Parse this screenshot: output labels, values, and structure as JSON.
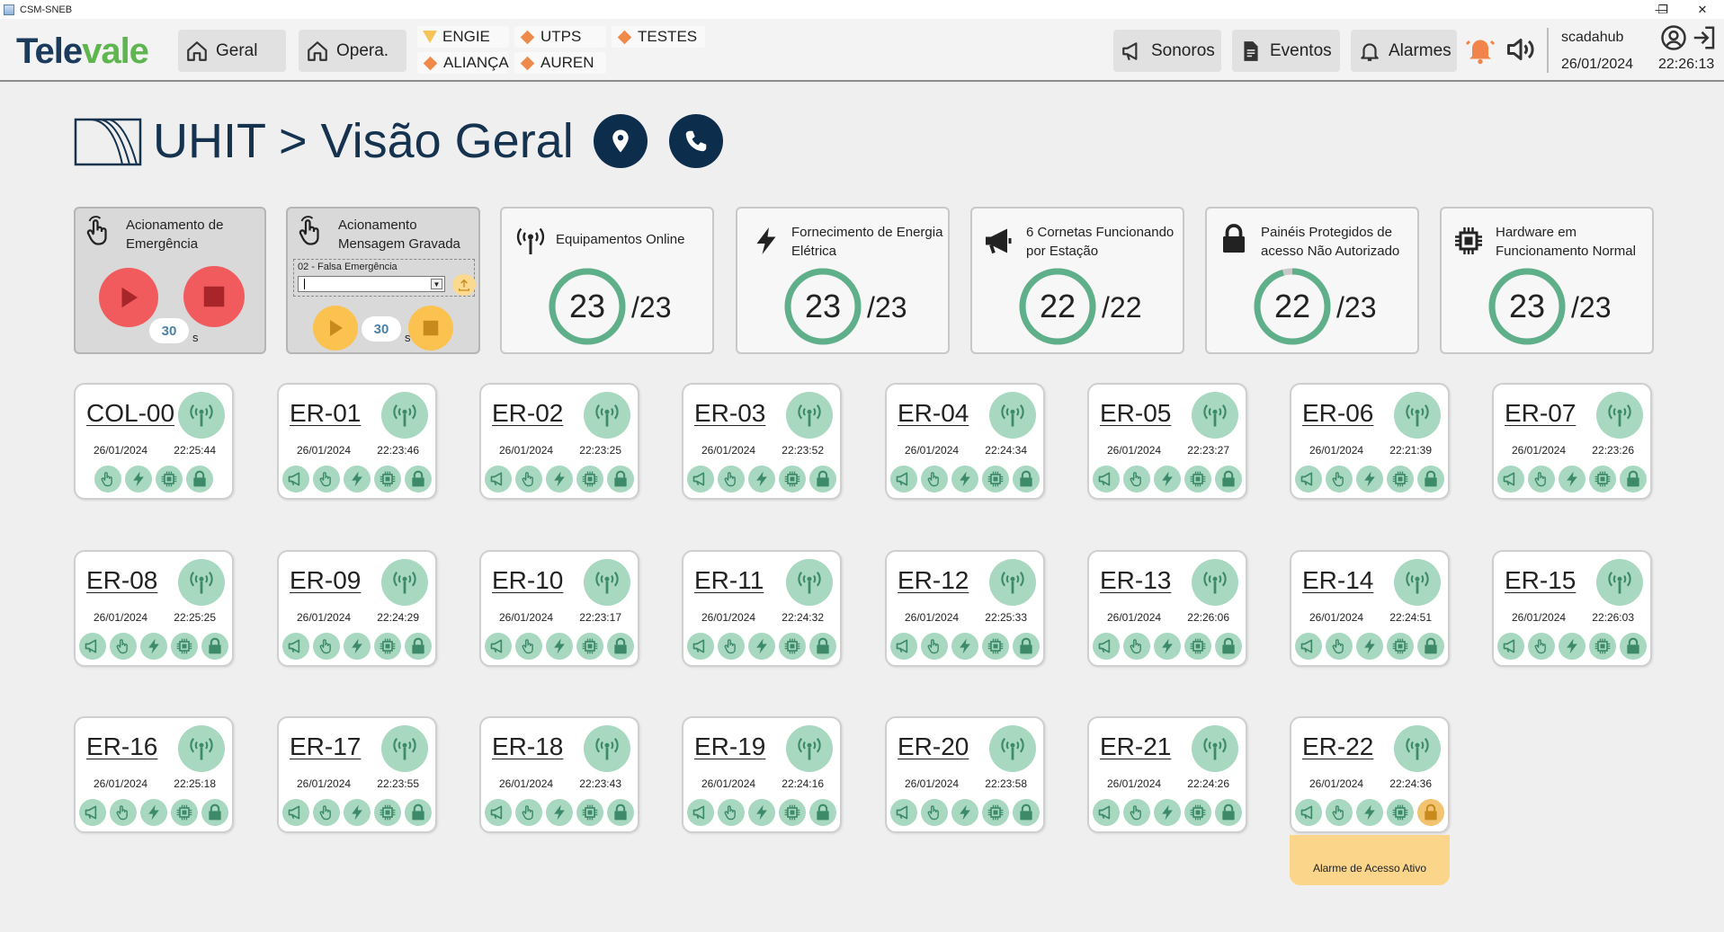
{
  "window": {
    "title": "CSM-SNEB",
    "controls": [
      "—",
      "❐",
      "✕"
    ]
  },
  "brand": {
    "logo_part1": "Tele",
    "logo_part2": "vale"
  },
  "nav": {
    "geral": "Geral",
    "opera": "Opera."
  },
  "companies": [
    "ENGIE",
    "UTPS",
    "TESTES",
    "ALIANÇA",
    "AUREN"
  ],
  "toolbar": {
    "sonoros": "Sonoros",
    "eventos": "Eventos",
    "alarmes": "Alarmes"
  },
  "user": {
    "name": "scadahub",
    "date": "26/01/2024",
    "time": "22:26:13"
  },
  "page": {
    "title": "UHIT > Visão Geral"
  },
  "actions": {
    "emergency": {
      "label": "Acionamento de Emergência",
      "seconds": "30",
      "unit": "s"
    },
    "recorded": {
      "label": "Acionamento Mensagem Gravada",
      "message_label": "02 - Falsa Emergência",
      "message_value": "",
      "seconds": "30",
      "unit": "s"
    }
  },
  "summary": [
    {
      "label": "Equipamentos Online",
      "value": 23,
      "total": "/23",
      "icon": "antenna-icon"
    },
    {
      "label": "Fornecimento de Energia Elétrica",
      "value": 23,
      "total": "/23",
      "icon": "lightning-icon"
    },
    {
      "label": "6 Cornetas Funcionando por Estação",
      "value": 22,
      "total": "/22",
      "icon": "megaphone-icon"
    },
    {
      "label": "Painéis Protegidos de acesso Não Autorizado",
      "value": 22,
      "total": "/23",
      "icon": "lock-icon"
    },
    {
      "label": "Hardware em Funcionamento Normal",
      "value": 23,
      "total": "/23",
      "icon": "chip-icon"
    }
  ],
  "stations": [
    {
      "name": "COL-00",
      "date": "26/01/2024",
      "time": "22:25:44",
      "horn": false,
      "alarm": false
    },
    {
      "name": "ER-01",
      "date": "26/01/2024",
      "time": "22:23:46",
      "horn": true,
      "alarm": false
    },
    {
      "name": "ER-02",
      "date": "26/01/2024",
      "time": "22:23:25",
      "horn": true,
      "alarm": false
    },
    {
      "name": "ER-03",
      "date": "26/01/2024",
      "time": "22:23:52",
      "horn": true,
      "alarm": false
    },
    {
      "name": "ER-04",
      "date": "26/01/2024",
      "time": "22:24:34",
      "horn": true,
      "alarm": false
    },
    {
      "name": "ER-05",
      "date": "26/01/2024",
      "time": "22:23:27",
      "horn": true,
      "alarm": false
    },
    {
      "name": "ER-06",
      "date": "26/01/2024",
      "time": "22:21:39",
      "horn": true,
      "alarm": false
    },
    {
      "name": "ER-07",
      "date": "26/01/2024",
      "time": "22:23:26",
      "horn": true,
      "alarm": false
    },
    {
      "name": "ER-08",
      "date": "26/01/2024",
      "time": "22:25:25",
      "horn": true,
      "alarm": false
    },
    {
      "name": "ER-09",
      "date": "26/01/2024",
      "time": "22:24:29",
      "horn": true,
      "alarm": false
    },
    {
      "name": "ER-10",
      "date": "26/01/2024",
      "time": "22:23:17",
      "horn": true,
      "alarm": false
    },
    {
      "name": "ER-11",
      "date": "26/01/2024",
      "time": "22:24:32",
      "horn": true,
      "alarm": false
    },
    {
      "name": "ER-12",
      "date": "26/01/2024",
      "time": "22:25:33",
      "horn": true,
      "alarm": false
    },
    {
      "name": "ER-13",
      "date": "26/01/2024",
      "time": "22:26:06",
      "horn": true,
      "alarm": false
    },
    {
      "name": "ER-14",
      "date": "26/01/2024",
      "time": "22:24:51",
      "horn": true,
      "alarm": false
    },
    {
      "name": "ER-15",
      "date": "26/01/2024",
      "time": "22:26:03",
      "horn": true,
      "alarm": false
    },
    {
      "name": "ER-16",
      "date": "26/01/2024",
      "time": "22:25:18",
      "horn": true,
      "alarm": false
    },
    {
      "name": "ER-17",
      "date": "26/01/2024",
      "time": "22:23:55",
      "horn": true,
      "alarm": false
    },
    {
      "name": "ER-18",
      "date": "26/01/2024",
      "time": "22:23:43",
      "horn": true,
      "alarm": false
    },
    {
      "name": "ER-19",
      "date": "26/01/2024",
      "time": "22:24:16",
      "horn": true,
      "alarm": false
    },
    {
      "name": "ER-20",
      "date": "26/01/2024",
      "time": "22:23:58",
      "horn": true,
      "alarm": false
    },
    {
      "name": "ER-21",
      "date": "26/01/2024",
      "time": "22:24:26",
      "horn": true,
      "alarm": false
    },
    {
      "name": "ER-22",
      "date": "26/01/2024",
      "time": "22:24:36",
      "horn": true,
      "alarm": true,
      "alarm_text": "Alarme de Acesso Ativo"
    }
  ],
  "colors": {
    "ok_green": "#a8d8c0",
    "gauge_green": "#5fb08a",
    "alarm_orange": "#f2c371",
    "stop_red": "#e0393e",
    "play_red": "#f25b5e",
    "play_yellow": "#fbc24f",
    "navy": "#0d2d4d"
  }
}
